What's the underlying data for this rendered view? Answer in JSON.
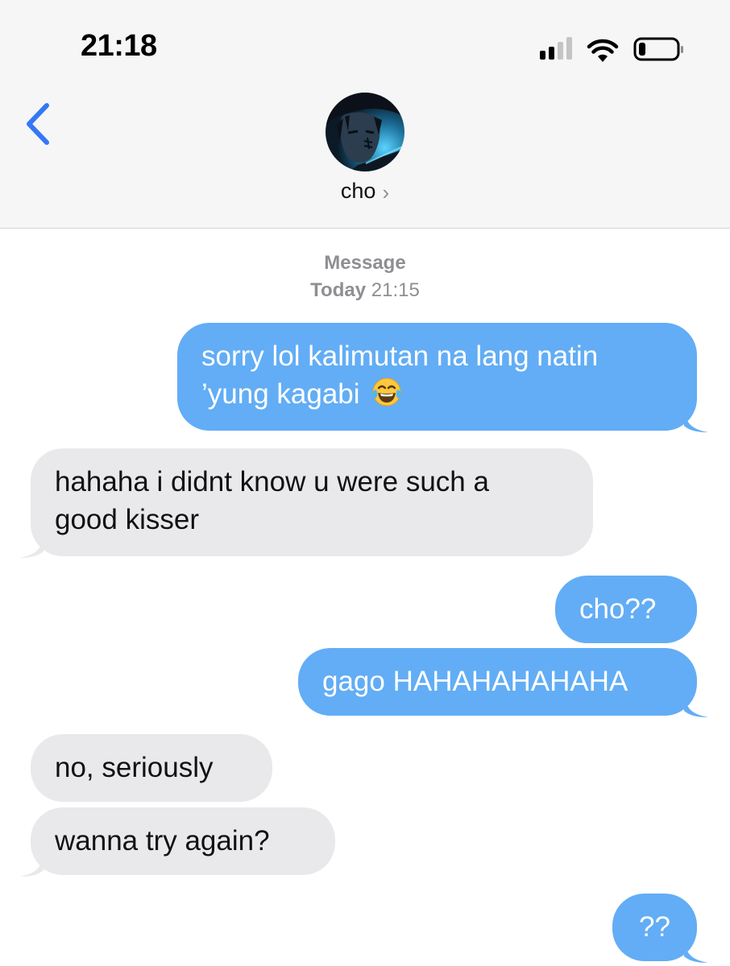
{
  "status_bar": {
    "time": "21:18"
  },
  "header": {
    "contact_name": "cho",
    "chevron": "›",
    "back_icon": "chevron-left-icon"
  },
  "conversation": {
    "service": "Message",
    "date_label": "Today",
    "date_time": "21:15",
    "messages": [
      {
        "from": "me",
        "line1": "sorry lol kalimutan na lang natin",
        "line2": "’yung kagabi",
        "emoji": "face-with-tears-of-joy"
      },
      {
        "from": "them",
        "line1": "hahaha i didnt know u were such a",
        "line2": "good kisser"
      },
      {
        "from": "me",
        "text": "cho??"
      },
      {
        "from": "me",
        "text": "gago HAHAHAHAHAHA"
      },
      {
        "from": "them",
        "text": "no, seriously"
      },
      {
        "from": "them",
        "text": "wanna try again?"
      },
      {
        "from": "me",
        "text": "??"
      }
    ]
  },
  "colors": {
    "sent_bubble": "#62adf5",
    "received_bubble": "#e9e9ec",
    "accent": "#3478f6"
  }
}
